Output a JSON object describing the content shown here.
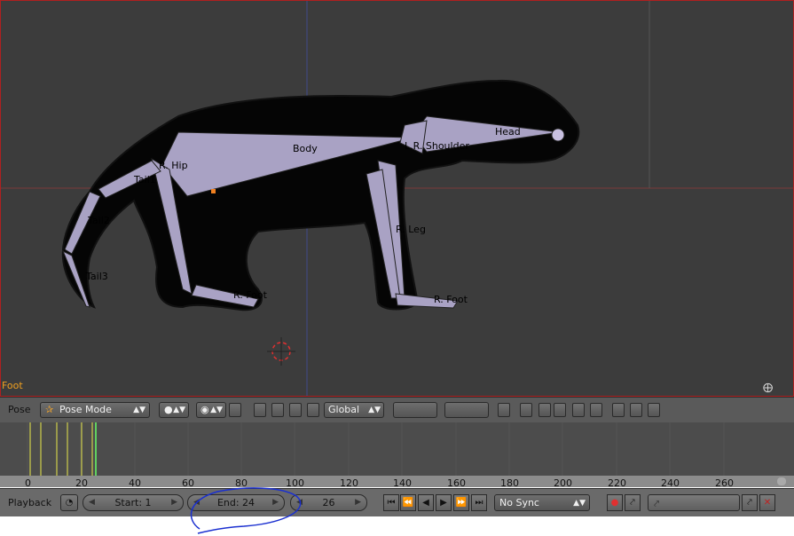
{
  "viewport": {
    "active_object": "Foot",
    "bone_labels": {
      "body": "Body",
      "head": "Head",
      "r_hip": "R. Hip",
      "tail1": "Tail1",
      "tail2": "Tail2",
      "tail3": "Tail3",
      "foot_back": "R. Foot",
      "shoulder": "L.R. Shoulder",
      "leg": "R. Leg",
      "foot_front": "R. Foot"
    }
  },
  "view3d_header": {
    "editor_label": "Pose",
    "mode": "Pose Mode",
    "orientation": "Global"
  },
  "timeline": {
    "ruler_labels": [
      "0",
      "20",
      "40",
      "60",
      "80",
      "100",
      "120",
      "140",
      "160",
      "180",
      "200",
      "220",
      "240",
      "260"
    ]
  },
  "playback_header": {
    "playback_menu": "Playback",
    "start": "Start: 1",
    "end": "End: 24",
    "current_frame": "26",
    "sync": "No Sync"
  },
  "colors": {
    "accent_active": "#f0a020",
    "annotation_circle": "#1a2fd0",
    "keyframe_marker": "#e8e84a",
    "current_frame_line": "#60d060"
  }
}
